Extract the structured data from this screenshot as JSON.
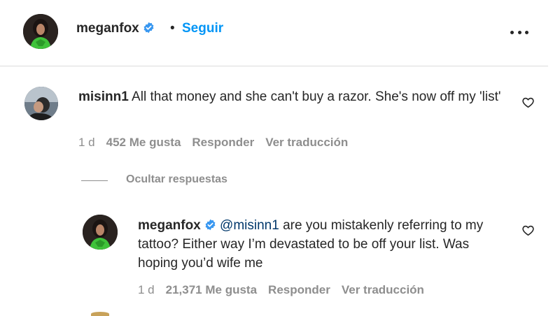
{
  "post_header": {
    "username": "meganfox",
    "separator": "•",
    "follow_label": "Seguir"
  },
  "comments": [
    {
      "username": "misinn1",
      "text": "All that money and she can't buy a razor. She's now off my 'list'",
      "time": "1 d",
      "likes": "452 Me gusta",
      "reply_label": "Responder",
      "translate_label": "Ver traducción"
    }
  ],
  "replies_toggle": "Ocultar respuestas",
  "replies": [
    {
      "username": "meganfox",
      "mention": "@misinn1",
      "text": " are you mistakenly referring to my tattoo? Either way I’m devastated to be off your list. Was hoping you’d wife me",
      "time": "1 d",
      "likes": "21,371 Me gusta",
      "reply_label": "Responder",
      "translate_label": "Ver traducción"
    }
  ],
  "colors": {
    "accent": "#0095f6",
    "mention": "#00376b",
    "verified": "#3897f0",
    "muted": "#8e8e8e"
  },
  "icons": [
    "verified-badge-icon",
    "more-options-icon",
    "heart-icon"
  ]
}
